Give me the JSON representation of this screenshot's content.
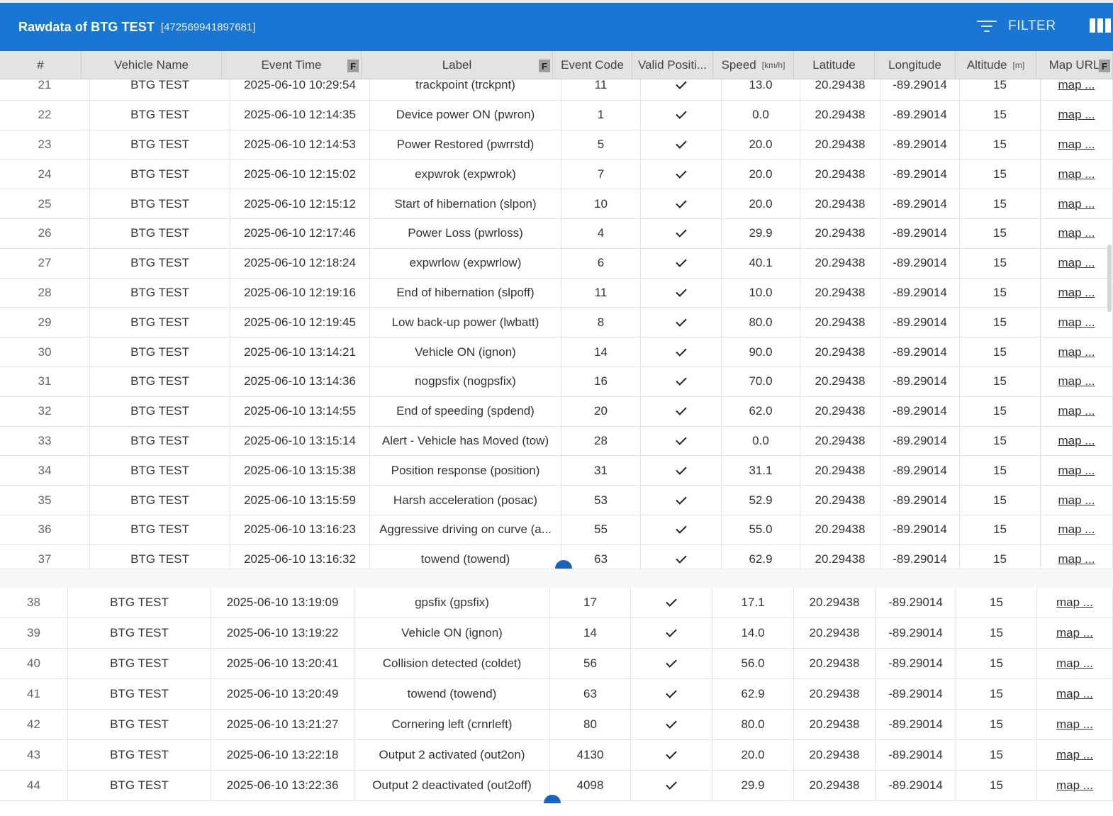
{
  "title": {
    "name": "Rawdata of BTG TEST",
    "id": "[472569941897681]",
    "filter_label": "FILTER"
  },
  "icons": {
    "filter": "filter-icon",
    "columns": "view-columns-icon"
  },
  "columns": [
    {
      "label": "#"
    },
    {
      "label": "Vehicle Name"
    },
    {
      "label": "Event Time",
      "filter": "F"
    },
    {
      "label": "Label",
      "filter": "F"
    },
    {
      "label": "Event Code"
    },
    {
      "label": "Valid Positi..."
    },
    {
      "label": "Speed",
      "unit": "[km/h]"
    },
    {
      "label": "Latitude"
    },
    {
      "label": "Longitude"
    },
    {
      "label": "Altitude",
      "unit": "[m]"
    },
    {
      "label": "Map URL",
      "filter": "F"
    }
  ],
  "rows_top": [
    {
      "n": "21",
      "vehicle": "BTG TEST",
      "time": "2025-06-10 10:29:54",
      "label": "trackpoint (trckpnt)",
      "code": "11",
      "valid": true,
      "speed": "13.0",
      "lat": "20.29438",
      "lon": "-89.29014",
      "alt": "15",
      "map": "map ..."
    },
    {
      "n": "22",
      "vehicle": "BTG TEST",
      "time": "2025-06-10 12:14:35",
      "label": "Device power ON (pwron)",
      "code": "1",
      "valid": true,
      "speed": "0.0",
      "lat": "20.29438",
      "lon": "-89.29014",
      "alt": "15",
      "map": "map ..."
    },
    {
      "n": "23",
      "vehicle": "BTG TEST",
      "time": "2025-06-10 12:14:53",
      "label": "Power Restored (pwrrstd)",
      "code": "5",
      "valid": true,
      "speed": "20.0",
      "lat": "20.29438",
      "lon": "-89.29014",
      "alt": "15",
      "map": "map ..."
    },
    {
      "n": "24",
      "vehicle": "BTG TEST",
      "time": "2025-06-10 12:15:02",
      "label": "expwrok (expwrok)",
      "code": "7",
      "valid": true,
      "speed": "20.0",
      "lat": "20.29438",
      "lon": "-89.29014",
      "alt": "15",
      "map": "map ..."
    },
    {
      "n": "25",
      "vehicle": "BTG TEST",
      "time": "2025-06-10 12:15:12",
      "label": "Start of hibernation (slpon)",
      "code": "10",
      "valid": true,
      "speed": "20.0",
      "lat": "20.29438",
      "lon": "-89.29014",
      "alt": "15",
      "map": "map ..."
    },
    {
      "n": "26",
      "vehicle": "BTG TEST",
      "time": "2025-06-10 12:17:46",
      "label": "Power Loss (pwrloss)",
      "code": "4",
      "valid": true,
      "speed": "29.9",
      "lat": "20.29438",
      "lon": "-89.29014",
      "alt": "15",
      "map": "map ..."
    },
    {
      "n": "27",
      "vehicle": "BTG TEST",
      "time": "2025-06-10 12:18:24",
      "label": "expwrlow (expwrlow)",
      "code": "6",
      "valid": true,
      "speed": "40.1",
      "lat": "20.29438",
      "lon": "-89.29014",
      "alt": "15",
      "map": "map ..."
    },
    {
      "n": "28",
      "vehicle": "BTG TEST",
      "time": "2025-06-10 12:19:16",
      "label": "End of hibernation (slpoff)",
      "code": "11",
      "valid": true,
      "speed": "10.0",
      "lat": "20.29438",
      "lon": "-89.29014",
      "alt": "15",
      "map": "map ..."
    },
    {
      "n": "29",
      "vehicle": "BTG TEST",
      "time": "2025-06-10 12:19:45",
      "label": "Low back-up power (lwbatt)",
      "code": "8",
      "valid": true,
      "speed": "80.0",
      "lat": "20.29438",
      "lon": "-89.29014",
      "alt": "15",
      "map": "map ..."
    },
    {
      "n": "30",
      "vehicle": "BTG TEST",
      "time": "2025-06-10 13:14:21",
      "label": "Vehicle ON (ignon)",
      "code": "14",
      "valid": true,
      "speed": "90.0",
      "lat": "20.29438",
      "lon": "-89.29014",
      "alt": "15",
      "map": "map ..."
    },
    {
      "n": "31",
      "vehicle": "BTG TEST",
      "time": "2025-06-10 13:14:36",
      "label": "nogpsfix (nogpsfix)",
      "code": "16",
      "valid": true,
      "speed": "70.0",
      "lat": "20.29438",
      "lon": "-89.29014",
      "alt": "15",
      "map": "map ..."
    },
    {
      "n": "32",
      "vehicle": "BTG TEST",
      "time": "2025-06-10 13:14:55",
      "label": "End of speeding (spdend)",
      "code": "20",
      "valid": true,
      "speed": "62.0",
      "lat": "20.29438",
      "lon": "-89.29014",
      "alt": "15",
      "map": "map ..."
    },
    {
      "n": "33",
      "vehicle": "BTG TEST",
      "time": "2025-06-10 13:15:14",
      "label": "Alert - Vehicle has Moved (tow)",
      "code": "28",
      "valid": true,
      "speed": "0.0",
      "lat": "20.29438",
      "lon": "-89.29014",
      "alt": "15",
      "map": "map ..."
    },
    {
      "n": "34",
      "vehicle": "BTG TEST",
      "time": "2025-06-10 13:15:38",
      "label": "Position response (position)",
      "code": "31",
      "valid": true,
      "speed": "31.1",
      "lat": "20.29438",
      "lon": "-89.29014",
      "alt": "15",
      "map": "map ..."
    },
    {
      "n": "35",
      "vehicle": "BTG TEST",
      "time": "2025-06-10 13:15:59",
      "label": "Harsh acceleration (posac)",
      "code": "53",
      "valid": true,
      "speed": "52.9",
      "lat": "20.29438",
      "lon": "-89.29014",
      "alt": "15",
      "map": "map ..."
    },
    {
      "n": "36",
      "vehicle": "BTG TEST",
      "time": "2025-06-10 13:16:23",
      "label": "Aggressive driving on curve (a...",
      "code": "55",
      "valid": true,
      "speed": "55.0",
      "lat": "20.29438",
      "lon": "-89.29014",
      "alt": "15",
      "map": "map ..."
    },
    {
      "n": "37",
      "vehicle": "BTG TEST",
      "time": "2025-06-10 13:16:32",
      "label": "towend (towend)",
      "code": "63",
      "valid": true,
      "speed": "62.9",
      "lat": "20.29438",
      "lon": "-89.29014",
      "alt": "15",
      "map": "map ..."
    }
  ],
  "rows_bottom": [
    {
      "n": "38",
      "vehicle": "BTG TEST",
      "time": "2025-06-10 13:19:09",
      "label": "gpsfix (gpsfix)",
      "code": "17",
      "valid": true,
      "speed": "17.1",
      "lat": "20.29438",
      "lon": "-89.29014",
      "alt": "15",
      "map": "map ..."
    },
    {
      "n": "39",
      "vehicle": "BTG TEST",
      "time": "2025-06-10 13:19:22",
      "label": "Vehicle ON (ignon)",
      "code": "14",
      "valid": true,
      "speed": "14.0",
      "lat": "20.29438",
      "lon": "-89.29014",
      "alt": "15",
      "map": "map ..."
    },
    {
      "n": "40",
      "vehicle": "BTG TEST",
      "time": "2025-06-10 13:20:41",
      "label": "Collision detected (coldet)",
      "code": "56",
      "valid": true,
      "speed": "56.0",
      "lat": "20.29438",
      "lon": "-89.29014",
      "alt": "15",
      "map": "map ..."
    },
    {
      "n": "41",
      "vehicle": "BTG TEST",
      "time": "2025-06-10 13:20:49",
      "label": "towend (towend)",
      "code": "63",
      "valid": true,
      "speed": "62.9",
      "lat": "20.29438",
      "lon": "-89.29014",
      "alt": "15",
      "map": "map ..."
    },
    {
      "n": "42",
      "vehicle": "BTG TEST",
      "time": "2025-06-10 13:21:27",
      "label": "Cornering left (crnrleft)",
      "code": "80",
      "valid": true,
      "speed": "80.0",
      "lat": "20.29438",
      "lon": "-89.29014",
      "alt": "15",
      "map": "map ..."
    },
    {
      "n": "43",
      "vehicle": "BTG TEST",
      "time": "2025-06-10 13:22:18",
      "label": "Output 2 activated (out2on)",
      "code": "4130",
      "valid": true,
      "speed": "20.0",
      "lat": "20.29438",
      "lon": "-89.29014",
      "alt": "15",
      "map": "map ..."
    },
    {
      "n": "44",
      "vehicle": "BTG TEST",
      "time": "2025-06-10 13:22:36",
      "label": "Output 2 deactivated (out2off)",
      "code": "4098",
      "valid": true,
      "speed": "29.9",
      "lat": "20.29438",
      "lon": "-89.29014",
      "alt": "15",
      "map": "map ..."
    }
  ]
}
